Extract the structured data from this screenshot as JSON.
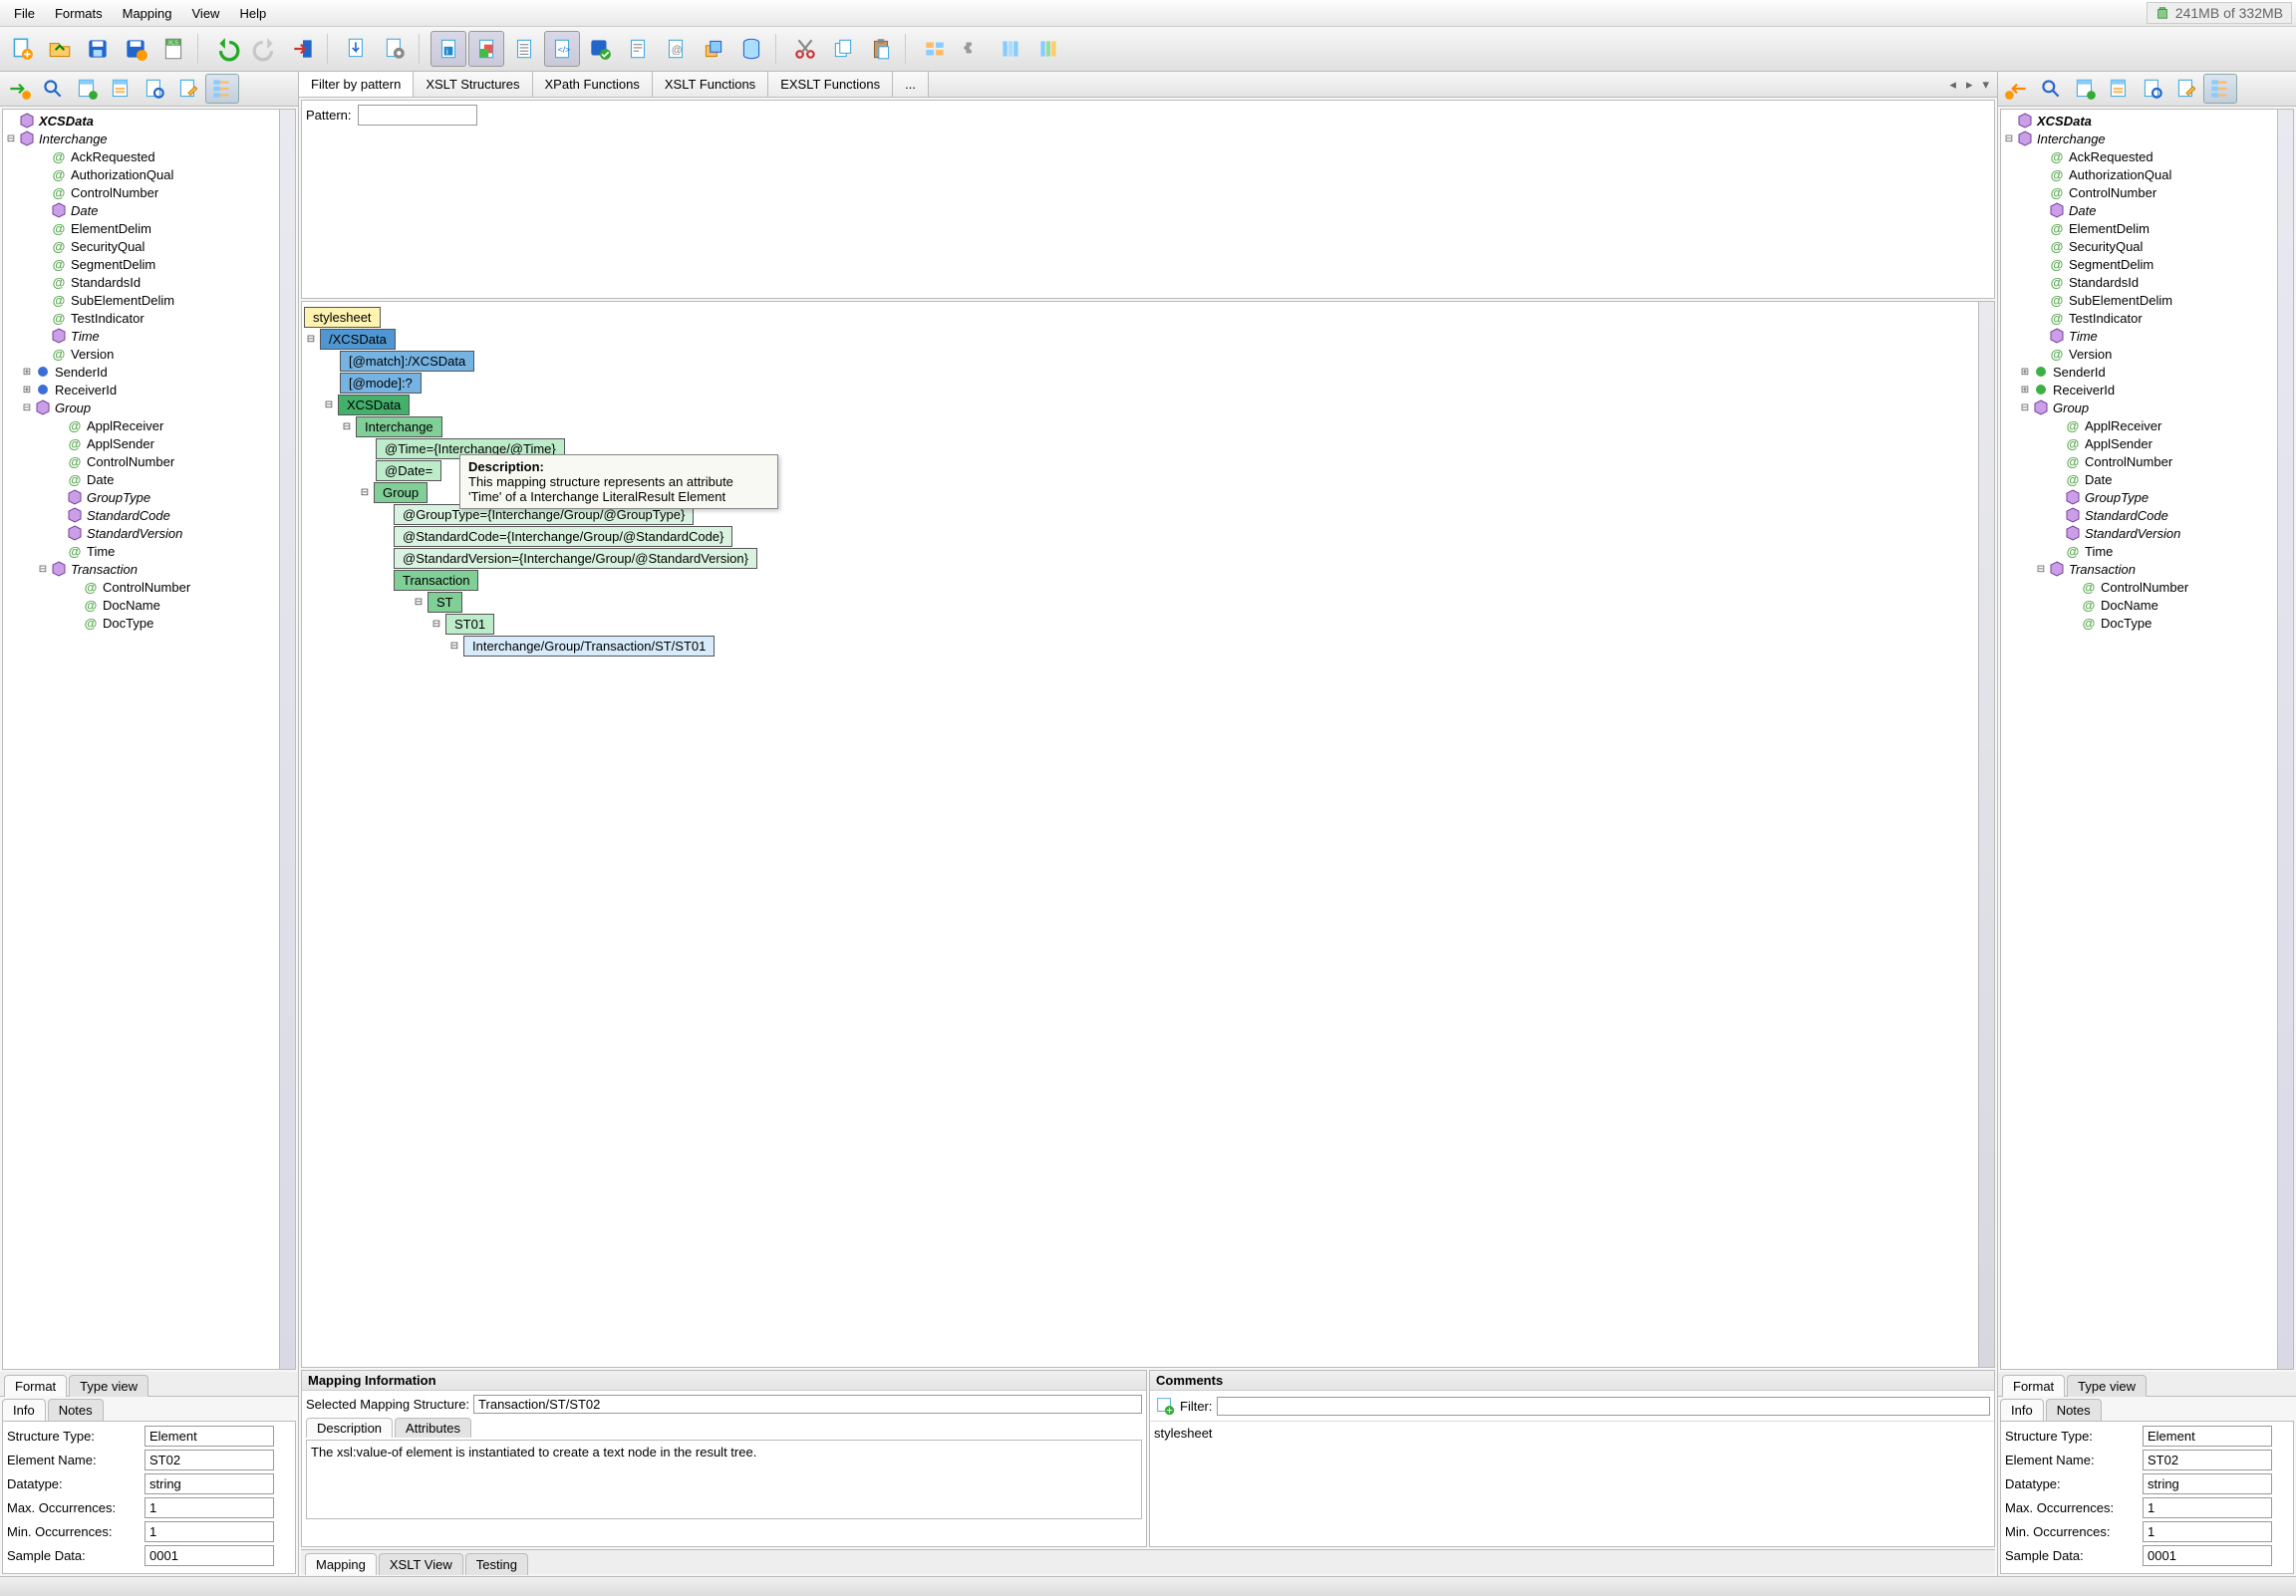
{
  "menu": {
    "file": "File",
    "formats": "Formats",
    "mapping": "Mapping",
    "view": "View",
    "help": "Help"
  },
  "memory": {
    "text": "241MB of 332MB"
  },
  "center_tabs": {
    "filter": "Filter by pattern",
    "xslt_struct": "XSLT Structures",
    "xpath_fn": "XPath Functions",
    "xslt_fn": "XSLT Functions",
    "exslt_fn": "EXSLT Functions",
    "more": "..."
  },
  "pattern": {
    "label": "Pattern:"
  },
  "mapping_nodes": {
    "stylesheet": "stylesheet",
    "xcsdata_root": "/XCSData",
    "match_attr": "[@match]:/XCSData",
    "mode_attr": "[@mode]:?",
    "xcsdata": "XCSData",
    "interchange": "Interchange",
    "time_attr": "@Time={Interchange/@Time}",
    "date_attr": "@Date=",
    "group": "Group",
    "grouptype_attr": "@GroupType={Interchange/Group/@GroupType}",
    "stdcode_attr": "@StandardCode={Interchange/Group/@StandardCode}",
    "stdver_attr": "@StandardVersion={Interchange/Group/@StandardVersion}",
    "transaction": "Transaction",
    "st": "ST",
    "st01": "ST01",
    "st01_path": "Interchange/Group/Transaction/ST/ST01"
  },
  "tooltip": {
    "title": "Description:",
    "body": "This mapping structure represents an attribute 'Time' of a Interchange LiteralResult Element"
  },
  "mapping_info": {
    "title": "Mapping Information",
    "sel_label": "Selected Mapping Structure:",
    "sel_value": "Transaction/ST/ST02",
    "desc_tab": "Description",
    "attr_tab": "Attributes",
    "desc_text": "The xsl:value-of element is instantiated to create a text node in the result tree."
  },
  "comments": {
    "title": "Comments",
    "filter_label": "Filter:",
    "item": "stylesheet"
  },
  "bottom_center_tabs": {
    "mapping": "Mapping",
    "xslt_view": "XSLT View",
    "testing": "Testing"
  },
  "tree": {
    "root": "XCSData",
    "interchange": "Interchange",
    "interchange_attrs": [
      "AckRequested",
      "AuthorizationQual",
      "ControlNumber"
    ],
    "date": "Date",
    "interchange_attrs2": [
      "ElementDelim",
      "SecurityQual",
      "SegmentDelim",
      "StandardsId",
      "SubElementDelim",
      "TestIndicator"
    ],
    "time_el": "Time",
    "version": "Version",
    "senderid": "SenderId",
    "receiverid": "ReceiverId",
    "group": "Group",
    "group_attrs": [
      "ApplReceiver",
      "ApplSender",
      "ControlNumber",
      "Date"
    ],
    "grouptype": "GroupType",
    "standardcode": "StandardCode",
    "standardversion": "StandardVersion",
    "time": "Time",
    "transaction": "Transaction",
    "trans_attrs": [
      "ControlNumber",
      "DocName",
      "DocType"
    ]
  },
  "side_bottom": {
    "format": "Format",
    "typeview": "Type view"
  },
  "info_tabs": {
    "info": "Info",
    "notes": "Notes"
  },
  "info": {
    "structure_type": {
      "lbl": "Structure Type:",
      "val": "Element"
    },
    "element_name": {
      "lbl": "Element Name:",
      "val": "ST02"
    },
    "datatype": {
      "lbl": "Datatype:",
      "val": "string"
    },
    "max_occ": {
      "lbl": "Max. Occurrences:",
      "val": "1"
    },
    "min_occ": {
      "lbl": "Min. Occurrences:",
      "val": "1"
    },
    "sample": {
      "lbl": "Sample Data:",
      "val": "0001"
    }
  }
}
